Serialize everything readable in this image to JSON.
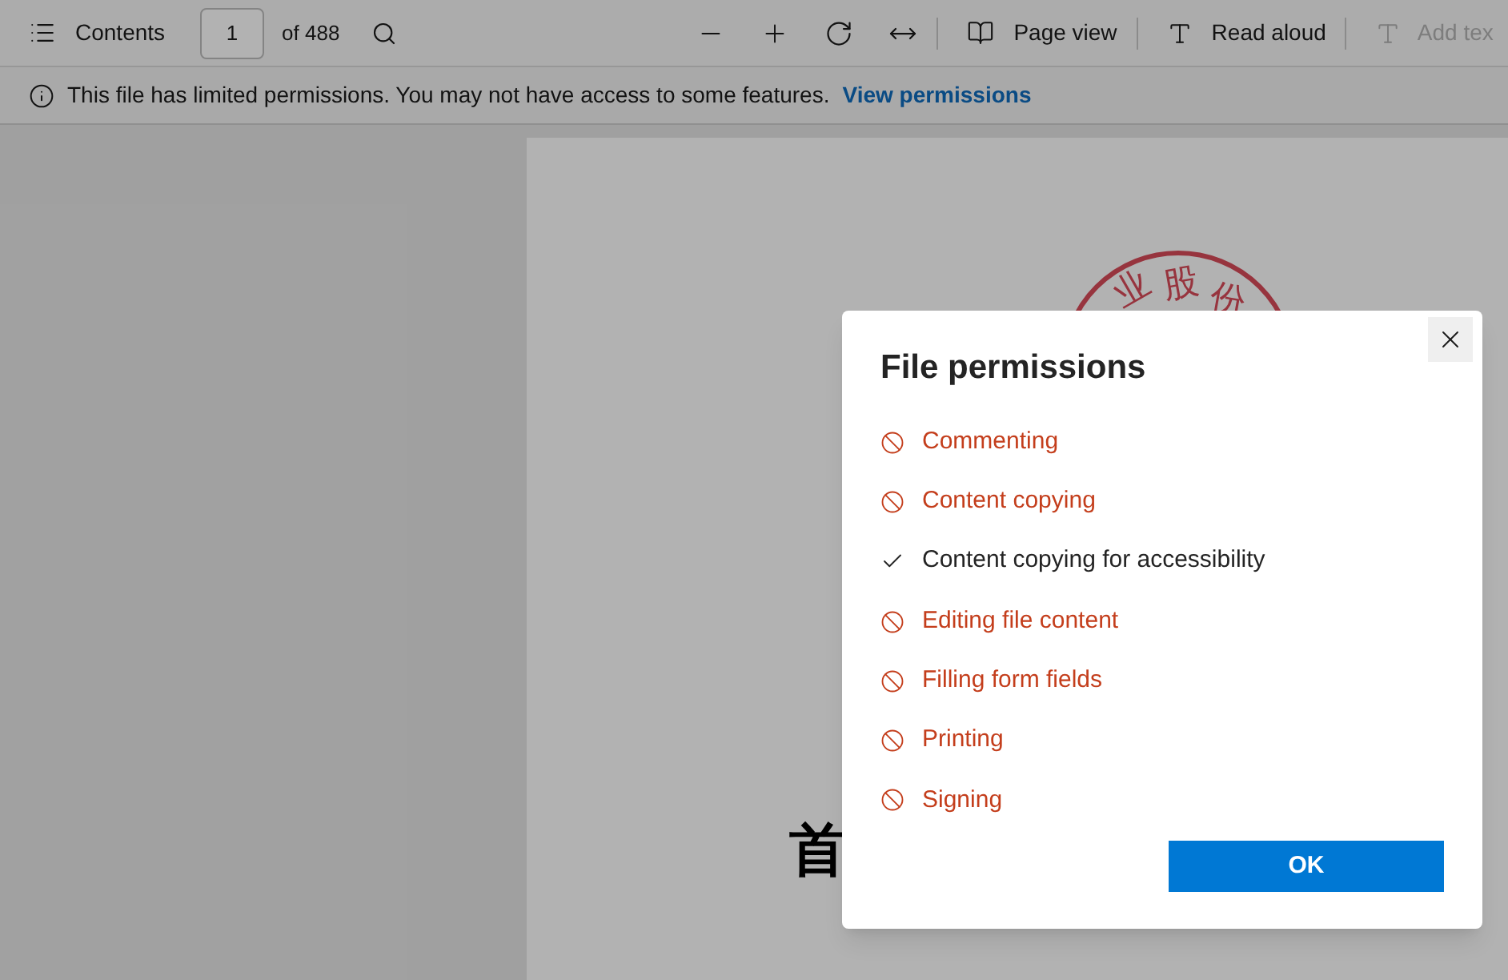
{
  "toolbar": {
    "contents_label": "Contents",
    "page_number": "1",
    "page_count": "of 488",
    "page_view_label": "Page view",
    "read_aloud_label": "Read aloud",
    "add_text": {
      "label": "Add tex",
      "disabled": true
    }
  },
  "info_bar": {
    "message": "This file has limited permissions. You may not have access to some features.",
    "link": "View permissions"
  },
  "document": {
    "stamp_chars": [
      "业",
      "股",
      "份"
    ],
    "title_visible": "首"
  },
  "dialog": {
    "title": "File permissions",
    "permissions": [
      {
        "label": "Commenting",
        "allowed": false
      },
      {
        "label": "Content copying",
        "allowed": false
      },
      {
        "label": "Content copying for accessibility",
        "allowed": true
      },
      {
        "label": "Editing file content",
        "allowed": false
      },
      {
        "label": "Filling form fields",
        "allowed": false
      },
      {
        "label": "Printing",
        "allowed": false
      },
      {
        "label": "Signing",
        "allowed": false
      }
    ],
    "ok_button": "OK"
  }
}
